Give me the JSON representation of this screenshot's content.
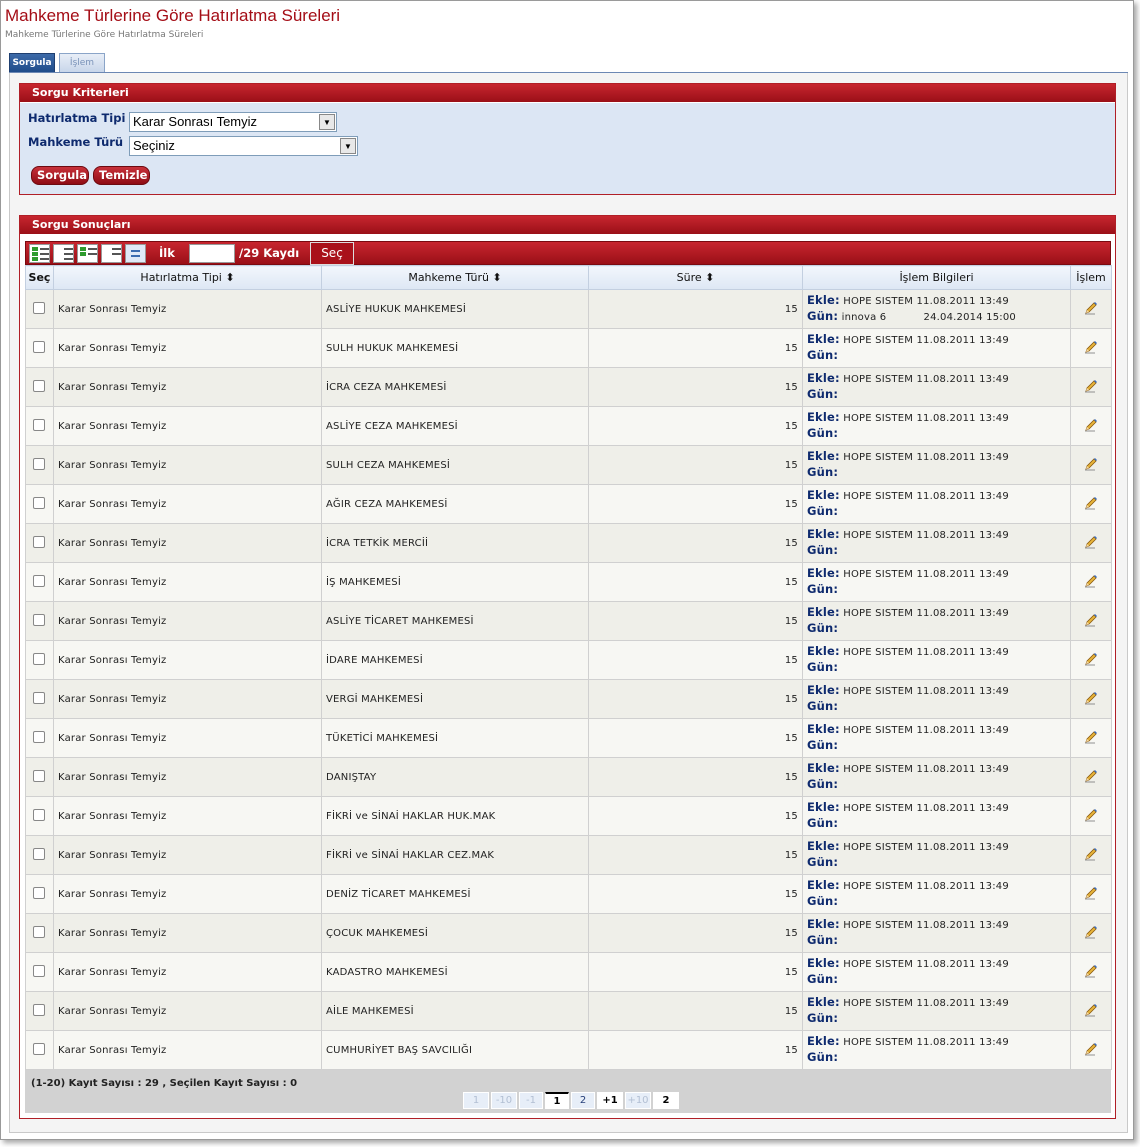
{
  "page": {
    "title": "Mahkeme Türlerine Göre Hatırlatma Süreleri",
    "subtitle": "Mahkeme Türlerine Göre Hatırlatma Süreleri"
  },
  "tabs": [
    {
      "label": "Sorgula",
      "active": true
    },
    {
      "label": "İşlem",
      "active": false
    }
  ],
  "criteria": {
    "header": "Sorgu Kriterleri",
    "hatirlatma_label": "Hatırlatma Tipi",
    "hatirlatma_value": "Karar Sonrası Temyiz",
    "mahkeme_label": "Mahkeme Türü",
    "mahkeme_value": "Seçiniz",
    "sorgula_label": "Sorgula",
    "temizle_label": "Temizle"
  },
  "results": {
    "header": "Sorgu Sonuçları",
    "toolbar": {
      "ilk_label": "İlk",
      "kayit_label": "/29 Kaydı",
      "sec_label": "Seç"
    },
    "columns": {
      "sec": "Seç",
      "hatirlatma": "Hatırlatma Tipi ⬍",
      "mahkeme": "Mahkeme Türü ⬍",
      "sure": "Süre ⬍",
      "islem_bilgileri": "İşlem Bilgileri",
      "islem": "İşlem"
    },
    "info_labels": {
      "ekle": "Ekle:",
      "gun": "Gün:"
    },
    "rows": [
      {
        "tip": "Karar Sonrası Temyiz",
        "mahkeme": "ASLİYE HUKUK MAHKEMESİ",
        "sure": "15",
        "ekle": "HOPE SISTEM 11.08.2011 13:49",
        "gun": "innova 6           24.04.2014 15:00"
      },
      {
        "tip": "Karar Sonrası Temyiz",
        "mahkeme": "SULH HUKUK MAHKEMESİ",
        "sure": "15",
        "ekle": "HOPE SISTEM 11.08.2011 13:49",
        "gun": ""
      },
      {
        "tip": "Karar Sonrası Temyiz",
        "mahkeme": "İCRA CEZA MAHKEMESİ",
        "sure": "15",
        "ekle": "HOPE SISTEM 11.08.2011 13:49",
        "gun": ""
      },
      {
        "tip": "Karar Sonrası Temyiz",
        "mahkeme": "ASLİYE CEZA MAHKEMESİ",
        "sure": "15",
        "ekle": "HOPE SISTEM 11.08.2011 13:49",
        "gun": ""
      },
      {
        "tip": "Karar Sonrası Temyiz",
        "mahkeme": "SULH CEZA MAHKEMESİ",
        "sure": "15",
        "ekle": "HOPE SISTEM 11.08.2011 13:49",
        "gun": ""
      },
      {
        "tip": "Karar Sonrası Temyiz",
        "mahkeme": "AĞIR CEZA MAHKEMESİ",
        "sure": "15",
        "ekle": "HOPE SISTEM 11.08.2011 13:49",
        "gun": ""
      },
      {
        "tip": "Karar Sonrası Temyiz",
        "mahkeme": "İCRA TETKİK MERCİİ",
        "sure": "15",
        "ekle": "HOPE SISTEM 11.08.2011 13:49",
        "gun": ""
      },
      {
        "tip": "Karar Sonrası Temyiz",
        "mahkeme": "İŞ MAHKEMESİ",
        "sure": "15",
        "ekle": "HOPE SISTEM 11.08.2011 13:49",
        "gun": ""
      },
      {
        "tip": "Karar Sonrası Temyiz",
        "mahkeme": "ASLİYE TİCARET MAHKEMESİ",
        "sure": "15",
        "ekle": "HOPE SISTEM 11.08.2011 13:49",
        "gun": ""
      },
      {
        "tip": "Karar Sonrası Temyiz",
        "mahkeme": "İDARE MAHKEMESİ",
        "sure": "15",
        "ekle": "HOPE SISTEM 11.08.2011 13:49",
        "gun": ""
      },
      {
        "tip": "Karar Sonrası Temyiz",
        "mahkeme": "VERGİ MAHKEMESİ",
        "sure": "15",
        "ekle": "HOPE SISTEM 11.08.2011 13:49",
        "gun": ""
      },
      {
        "tip": "Karar Sonrası Temyiz",
        "mahkeme": "TÜKETİCİ MAHKEMESİ",
        "sure": "15",
        "ekle": "HOPE SISTEM 11.08.2011 13:49",
        "gun": ""
      },
      {
        "tip": "Karar Sonrası Temyiz",
        "mahkeme": "DANIŞTAY",
        "sure": "15",
        "ekle": "HOPE SISTEM 11.08.2011 13:49",
        "gun": ""
      },
      {
        "tip": "Karar Sonrası Temyiz",
        "mahkeme": "FİKRİ ve SİNAİ HAKLAR HUK.MAK",
        "sure": "15",
        "ekle": "HOPE SISTEM 11.08.2011 13:49",
        "gun": ""
      },
      {
        "tip": "Karar Sonrası Temyiz",
        "mahkeme": "FİKRİ ve SİNAİ HAKLAR CEZ.MAK",
        "sure": "15",
        "ekle": "HOPE SISTEM 11.08.2011 13:49",
        "gun": ""
      },
      {
        "tip": "Karar Sonrası Temyiz",
        "mahkeme": "DENİZ TİCARET MAHKEMESİ",
        "sure": "15",
        "ekle": "HOPE SISTEM 11.08.2011 13:49",
        "gun": ""
      },
      {
        "tip": "Karar Sonrası Temyiz",
        "mahkeme": "ÇOCUK MAHKEMESİ",
        "sure": "15",
        "ekle": "HOPE SISTEM 11.08.2011 13:49",
        "gun": ""
      },
      {
        "tip": "Karar Sonrası Temyiz",
        "mahkeme": "KADASTRO MAHKEMESİ",
        "sure": "15",
        "ekle": "HOPE SISTEM 11.08.2011 13:49",
        "gun": ""
      },
      {
        "tip": "Karar Sonrası Temyiz",
        "mahkeme": "AİLE MAHKEMESİ",
        "sure": "15",
        "ekle": "HOPE SISTEM 11.08.2011 13:49",
        "gun": ""
      },
      {
        "tip": "Karar Sonrası Temyiz",
        "mahkeme": "CUMHURİYET BAŞ SAVCILIĞI",
        "sure": "15",
        "ekle": "HOPE SISTEM 11.08.2011 13:49",
        "gun": ""
      }
    ],
    "footer": {
      "count_text": "(1-20) Kayıt Sayısı : 29 , Seçilen Kayıt Sayısı : 0",
      "pager": [
        {
          "label": "1",
          "kind": "dis",
          "w": 26
        },
        {
          "label": "-10",
          "kind": "dis",
          "w": 26
        },
        {
          "label": "-1",
          "kind": "dis",
          "w": 24
        },
        {
          "label": "1",
          "kind": "cur",
          "w": 24
        },
        {
          "label": "2",
          "kind": "link",
          "w": 24
        },
        {
          "label": "+1",
          "kind": "bold",
          "w": 26
        },
        {
          "label": "+10",
          "kind": "dis",
          "w": 26
        },
        {
          "label": "2",
          "kind": "bold",
          "w": 26
        }
      ]
    }
  },
  "icons": {
    "pencil": "pencil-icon",
    "dropdown": "chevron-down-icon"
  }
}
